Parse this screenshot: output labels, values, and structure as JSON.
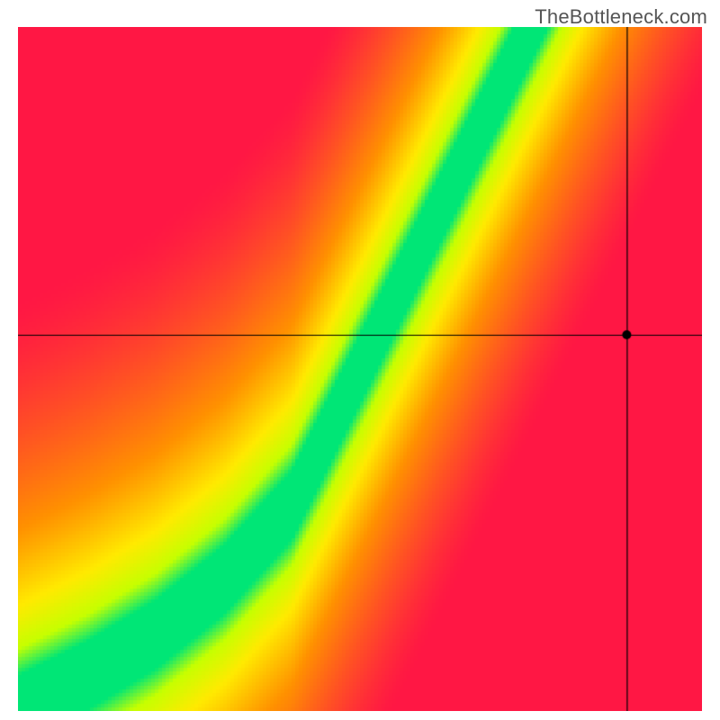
{
  "watermark": "TheBottleneck.com",
  "chart_data": {
    "type": "heatmap",
    "title": "",
    "xlabel": "",
    "ylabel": "",
    "xlim": [
      0,
      100
    ],
    "ylim": [
      0,
      100
    ],
    "crosshair": {
      "x": 89,
      "y": 55
    },
    "marker": {
      "x": 89,
      "y": 55,
      "radius": 5
    },
    "optimal_curve": {
      "description": "Green optimal band center y as a function of x",
      "points": [
        {
          "x": 0,
          "y": 0
        },
        {
          "x": 10,
          "y": 5
        },
        {
          "x": 20,
          "y": 11
        },
        {
          "x": 30,
          "y": 19
        },
        {
          "x": 40,
          "y": 30
        },
        {
          "x": 50,
          "y": 50
        },
        {
          "x": 55,
          "y": 60
        },
        {
          "x": 60,
          "y": 70
        },
        {
          "x": 65,
          "y": 80
        },
        {
          "x": 70,
          "y": 90
        },
        {
          "x": 75,
          "y": 100
        }
      ],
      "band_width": 5
    },
    "color_scale": {
      "0.00": "#ff1744",
      "0.50": "#ff9100",
      "0.75": "#ffea00",
      "0.90": "#c6ff00",
      "1.00": "#00e676"
    }
  }
}
